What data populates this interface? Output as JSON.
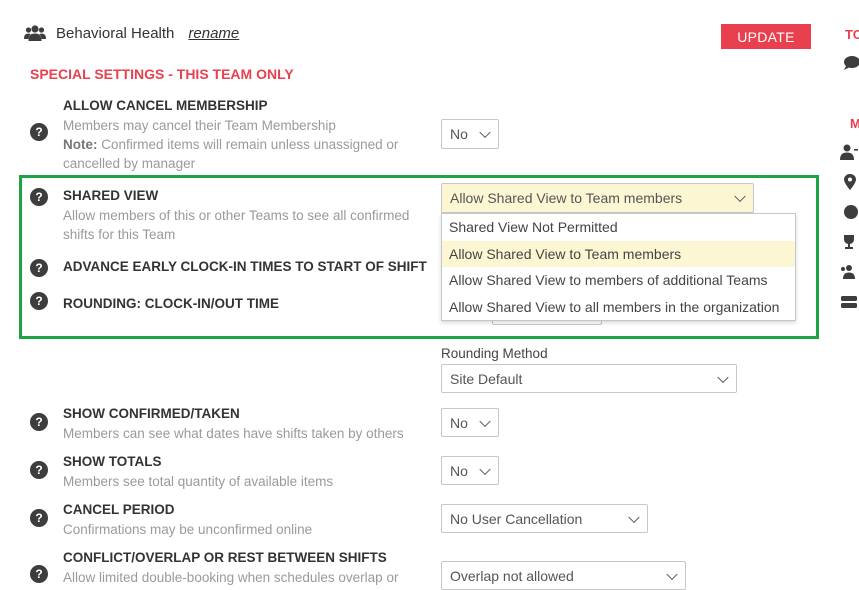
{
  "header": {
    "team_name": "Behavioral Health",
    "rename_label": "rename",
    "update_label": "UPDATE"
  },
  "section_title": "SPECIAL SETTINGS - THIS TEAM ONLY",
  "settings": {
    "allow_cancel": {
      "label": "ALLOW CANCEL MEMBERSHIP",
      "desc": "Members may cancel their Team Membership",
      "note_label": "Note:",
      "note_line1": "Confirmed items will remain unless unassigned or",
      "note_line2": "cancelled by manager",
      "value": "No"
    },
    "shared_view": {
      "label": "SHARED VIEW",
      "desc_line1": "Allow members of this or other Teams to see all confirmed",
      "desc_line2": "shifts for this Team",
      "value": "Allow Shared View to Team members",
      "options": [
        "Shared View Not Permitted",
        "Allow Shared View to Team members",
        "Allow Shared View to members of additional Teams",
        "Allow Shared View to all members in the organization"
      ]
    },
    "advance_early": {
      "label": "ADVANCE EARLY CLOCK-IN TIMES TO START OF SHIFT"
    },
    "rounding": {
      "label": "ROUNDING: CLOCK-IN/OUT TIME",
      "method_label": "Rounding Method",
      "method_value": "Site Default"
    },
    "show_confirmed": {
      "label": "SHOW CONFIRMED/TAKEN",
      "desc": "Members can see what dates have shifts taken by others",
      "value": "No"
    },
    "show_totals": {
      "label": "SHOW TOTALS",
      "desc": "Members see total quantity of available items",
      "value": "No"
    },
    "cancel_period": {
      "label": "CANCEL PERIOD",
      "desc": "Confirmations may be unconfirmed online",
      "value": "No User Cancellation"
    },
    "conflict": {
      "label": "CONFLICT/OVERLAP OR REST BETWEEN SHIFTS",
      "desc": "Allow limited double-booking when schedules overlap or",
      "value": "Overlap not allowed"
    }
  },
  "right_panel": {
    "heading1": "TO",
    "heading2": "M"
  },
  "colors": {
    "accent_red": "#e8404e",
    "highlight_green": "#1fa445",
    "selected_option": "#fdf6d3"
  }
}
